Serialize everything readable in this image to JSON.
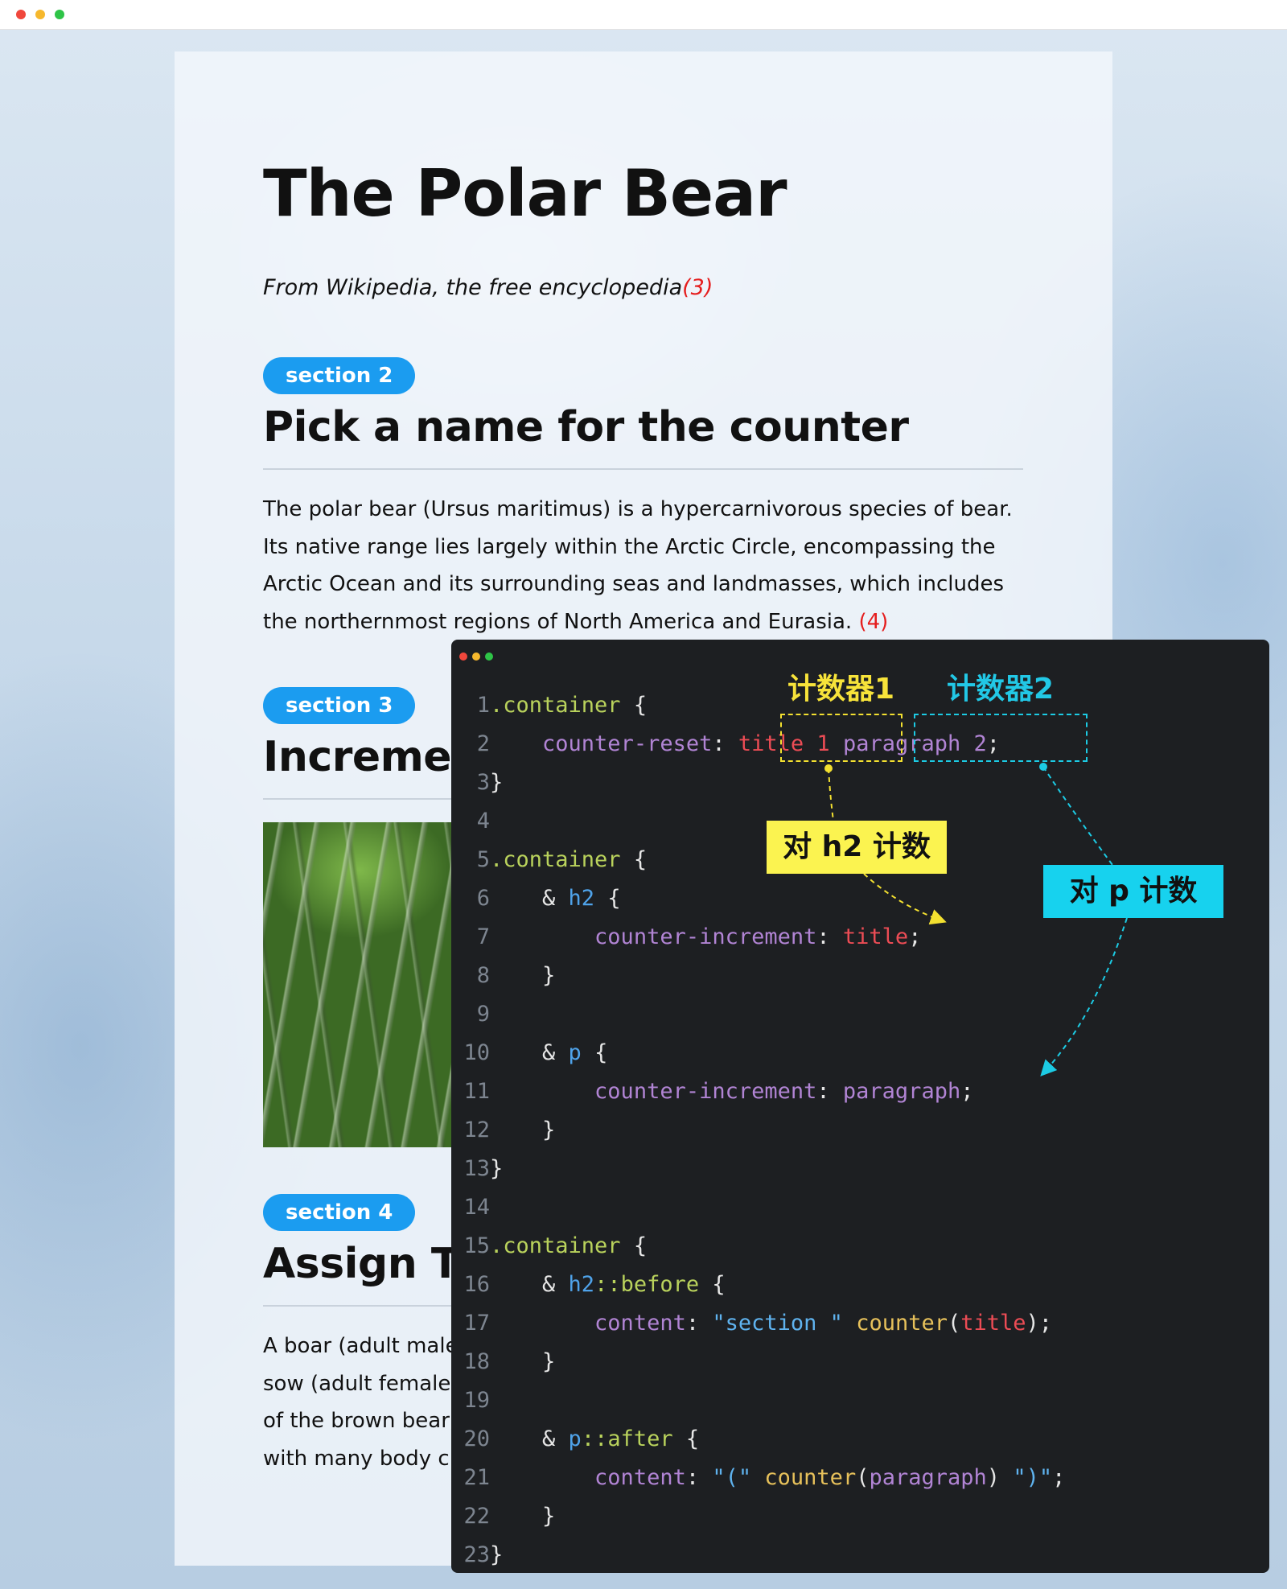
{
  "article": {
    "title": "The Polar Bear",
    "subtitle": "From Wikipedia, the free encyclopedia",
    "subtitle_counter": "(3)",
    "sections": [
      {
        "badge": "section 2",
        "heading": "Pick a name for the counter",
        "paragraph": "The polar bear (Ursus maritimus) is a hypercarnivorous species of bear. Its native range lies largely within the Arctic Circle, encompassing the Arctic Ocean and its surrounding seas and landmasses, which includes the northernmost regions of North America and Eurasia.",
        "paragraph_counter": "(4)"
      },
      {
        "badge": "section 3",
        "heading": "Incremen"
      },
      {
        "badge": "section 4",
        "heading": "Assign Th",
        "paragraph_lines": [
          "A boar (adult male",
          "sow (adult female",
          "of the brown bear,",
          "with many body cl"
        ]
      }
    ]
  },
  "code": {
    "line_numbers": [
      "1",
      "2",
      "3",
      "4",
      "5",
      "6",
      "7",
      "8",
      "9",
      "10",
      "11",
      "12",
      "13",
      "14",
      "15",
      "16",
      "17",
      "18",
      "19",
      "20",
      "21",
      "22",
      "23"
    ],
    "tokens": {
      "l1_sel": ".container",
      "l1_brace": " {",
      "l2_prop": "counter-reset",
      "l2_colon": ": ",
      "l2_v1": "title 1",
      "l2_sp": " ",
      "l2_v2": "paragraph 2",
      "l2_semi": ";",
      "l3": "}",
      "l5_sel": ".container",
      "l5_brace": " {",
      "l6_amp": "& ",
      "l6_tag": "h2",
      "l6_brace": " {",
      "l7_prop": "counter-increment",
      "l7_colon": ": ",
      "l7_val": "title",
      "l7_semi": ";",
      "l8": "}",
      "l10_amp": "& ",
      "l10_tag": "p",
      "l10_brace": " {",
      "l11_prop": "counter-increment",
      "l11_colon": ": ",
      "l11_val": "paragraph",
      "l11_semi": ";",
      "l12": "}",
      "l13": "}",
      "l15_sel": ".container",
      "l15_brace": " {",
      "l16_amp": "& ",
      "l16_tag": "h2",
      "l16_pseudo": "::before",
      "l16_brace": " {",
      "l17_prop": "content",
      "l17_colon": ": ",
      "l17_str": "\"section \"",
      "l17_fn": "counter",
      "l17_open": "(",
      "l17_arg": "title",
      "l17_close": ");",
      "l18": "}",
      "l20_amp": "& ",
      "l20_tag": "p",
      "l20_pseudo": "::after",
      "l20_brace": " {",
      "l21_prop": "content",
      "l21_colon": ": ",
      "l21_str1": "\"(\"",
      "l21_fn": "counter",
      "l21_open": "(",
      "l21_arg": "paragraph",
      "l21_close": ")",
      "l21_str2": "\")\"",
      "l21_semi": ";",
      "l22": "}",
      "l23": "}"
    }
  },
  "annotations": {
    "counter1_label": "计数器1",
    "counter2_label": "计数器2",
    "h2_callout": "对 h2 计数",
    "p_callout": "对 p 计数"
  },
  "colors": {
    "badge": "#1b9cf0",
    "counter_red": "#e51e1e",
    "code_bg": "#1d1f22",
    "highlight_yellow": "#f3e030",
    "highlight_cyan": "#1ccbe4"
  }
}
